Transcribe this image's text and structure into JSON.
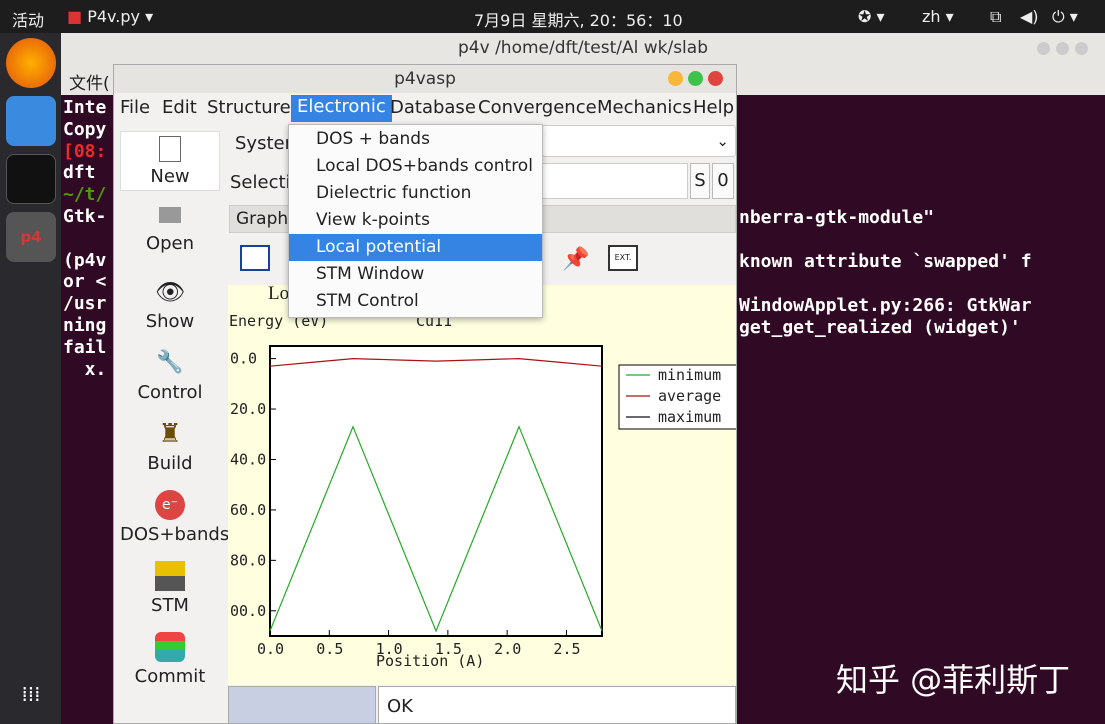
{
  "topbar": {
    "activities": "活动",
    "app_name": "P4v.py ▾",
    "clock": "7月9日 星期六, 20：56：10",
    "lang": "zh ▾"
  },
  "terminal": {
    "title": "p4v  /home/dft/test/Al wk/slab",
    "menu_first": "文件(",
    "lines": [
      {
        "text": "Inte",
        "color": "#ffffff"
      },
      {
        "text": "Copy",
        "color": "#ffffff"
      },
      {
        "text": "[08:",
        "color": "#ef2929"
      },
      {
        "text": "dft ",
        "color": "#ffffff"
      },
      {
        "text": "~/t/",
        "color": "#4e9a06"
      },
      {
        "text": "Gtk-",
        "color": "#ffffff"
      },
      {
        "text": "",
        "color": "#ffffff"
      },
      {
        "text": "(p4v",
        "color": "#ffffff"
      },
      {
        "text": "or <",
        "color": "#ffffff"
      },
      {
        "text": "/usr",
        "color": "#ffffff"
      },
      {
        "text": "ning",
        "color": "#ffffff"
      },
      {
        "text": "fail",
        "color": "#ffffff"
      },
      {
        "text": "  x.",
        "color": "#ffffff"
      }
    ],
    "right_lines": [
      "nberra-gtk-module\"",
      "",
      "known attribute `swapped' f",
      "",
      "WindowApplet.py:266: GtkWar",
      "get_get_realized (widget)'"
    ]
  },
  "p4vasp": {
    "title": "p4vasp",
    "menu": [
      "File",
      "Edit",
      "Structure",
      "Electronic",
      "Database",
      "Convergence",
      "Mechanics",
      "Help"
    ],
    "system_label": "System",
    "selection_label": "Selectio",
    "s_button": "S",
    "zero_button": "0",
    "graph_tab": "Graph",
    "sidebar": [
      "New",
      "Open",
      "Show",
      "Control",
      "Build",
      "DOS+bands",
      "STM",
      "Commit"
    ],
    "dropdown": [
      "DOS + bands",
      "Local DOS+bands control",
      "Dielectric function",
      "View k-points",
      "Local potential",
      "STM Window",
      "STM Control"
    ],
    "status_ok": "OK"
  },
  "colors": {
    "accent": "#3584e4",
    "plot_bg": "#ffffe0"
  },
  "chart_data": {
    "type": "line",
    "title": "Lo                    dir.)",
    "subtitle": "Cu11",
    "ylabel": "Energy (eV)",
    "xlabel": "Position (A)",
    "xlim": [
      0,
      2.8
    ],
    "ylim": [
      -110,
      5
    ],
    "xticks": [
      "0.0",
      "0.5",
      "1.0",
      "1.5",
      "2.0",
      "2.5"
    ],
    "yticks": [
      "0.0",
      "20.0",
      "40.0",
      "60.0",
      "80.0",
      "00.0"
    ],
    "series": [
      {
        "name": "minimum",
        "color": "#22aa22",
        "x": [
          0,
          0.7,
          1.4,
          2.1,
          2.8
        ],
        "y": [
          -108,
          -27,
          -108,
          -27,
          -108
        ]
      },
      {
        "name": "average",
        "color": "#aa1111",
        "x": [
          0,
          0.35,
          0.7,
          1.05,
          1.4,
          1.75,
          2.1,
          2.45,
          2.8
        ],
        "y": [
          -3,
          -1.5,
          0,
          -0.5,
          -1,
          -0.5,
          0,
          -1.5,
          -3
        ]
      },
      {
        "name": "maximum",
        "color": "#111111",
        "x": [],
        "y": []
      }
    ]
  },
  "watermark": "知乎 @菲利斯丁"
}
